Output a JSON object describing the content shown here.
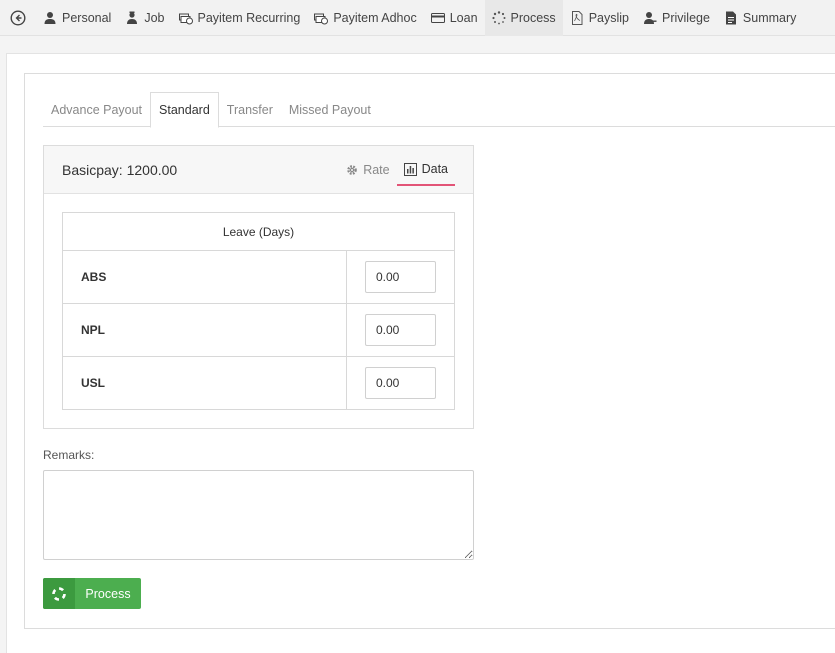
{
  "nav": {
    "items": [
      {
        "label": "Personal",
        "icon": "person-icon"
      },
      {
        "label": "Job",
        "icon": "worker-icon"
      },
      {
        "label": "Payitem Recurring",
        "icon": "money-icon"
      },
      {
        "label": "Payitem Adhoc",
        "icon": "money-icon"
      },
      {
        "label": "Loan",
        "icon": "card-icon"
      },
      {
        "label": "Process",
        "icon": "spinner-icon"
      },
      {
        "label": "Payslip",
        "icon": "pdf-icon"
      },
      {
        "label": "Privilege",
        "icon": "user-key-icon"
      },
      {
        "label": "Summary",
        "icon": "document-icon"
      }
    ],
    "active": "Process"
  },
  "tabs": [
    "Advance Payout",
    "Standard",
    "Transfer",
    "Missed Payout"
  ],
  "active_tab": "Standard",
  "card": {
    "basicpay": "Basicpay: 1200.00",
    "subtabs": [
      "Rate",
      "Data"
    ],
    "active_subtab": "Data"
  },
  "leave_table": {
    "header": "Leave (Days)",
    "rows": [
      {
        "label": "ABS",
        "value": "0.00"
      },
      {
        "label": "NPL",
        "value": "0.00"
      },
      {
        "label": "USL",
        "value": "0.00"
      }
    ]
  },
  "remarks": {
    "label": "Remarks:",
    "value": ""
  },
  "process_button": {
    "label": "Process"
  },
  "colors": {
    "accent_underline": "#e25477",
    "button_green": "#4cae4f"
  }
}
